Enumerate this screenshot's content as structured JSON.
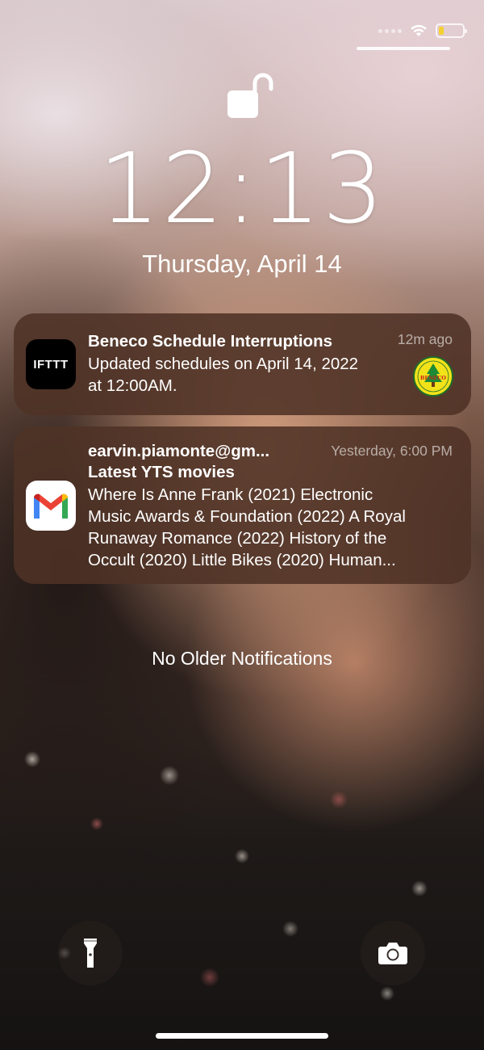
{
  "status_bar": {
    "battery_level": 0.2,
    "battery_color": "#f5d033"
  },
  "lock_screen": {
    "time": "12:13",
    "date": "Thursday, April 14",
    "lock_state": "unlocked"
  },
  "notifications": [
    {
      "app": "IFTTT",
      "app_icon": "ifttt-icon",
      "title": "Beneco Schedule Interruptions",
      "time": "12m ago",
      "body_lines": [
        "Updated schedules on April 14, 2022",
        "at 12:00AM."
      ],
      "attachment": "beneco-logo",
      "attachment_text": "BENECO"
    },
    {
      "app": "Gmail",
      "app_icon": "gmail-icon",
      "sender": "earvin.piamonte@gm...",
      "title": "Latest YTS movies",
      "time": "Yesterday, 6:00 PM",
      "body_lines": [
        "Where Is Anne Frank (2021) Electronic",
        "Music Awards & Foundation (2022) A Royal",
        "Runaway Romance (2022) History of the",
        "Occult (2020) Little Bikes (2020) Human..."
      ]
    }
  ],
  "footer": {
    "no_older": "No Older Notifications"
  },
  "controls": {
    "left": "flashlight-icon",
    "right": "camera-icon"
  },
  "colors": {
    "notification_bg": "#4e3226",
    "gmail_red": "#ea4335",
    "gmail_blue": "#4285f4",
    "gmail_green": "#34a853",
    "gmail_yellow": "#fbbc04"
  }
}
